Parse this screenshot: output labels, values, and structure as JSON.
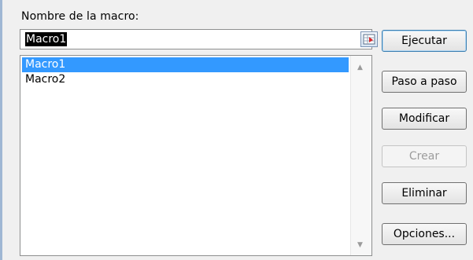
{
  "dialog": {
    "name_label": "Nombre de la macro:",
    "name_value": "Macro1"
  },
  "macros": [
    "Macro1",
    "Macro2"
  ],
  "selected_index": 0,
  "buttons": {
    "run": "Ejecutar",
    "step": "Paso a paso",
    "edit": "Modificar",
    "create": "Crear",
    "delete": "Eliminar",
    "options": "Opciones..."
  },
  "icons": {
    "ref_button": "range-select-icon",
    "scroll_up": "scroll-up-arrow-icon",
    "scroll_down": "scroll-down-arrow-icon"
  }
}
